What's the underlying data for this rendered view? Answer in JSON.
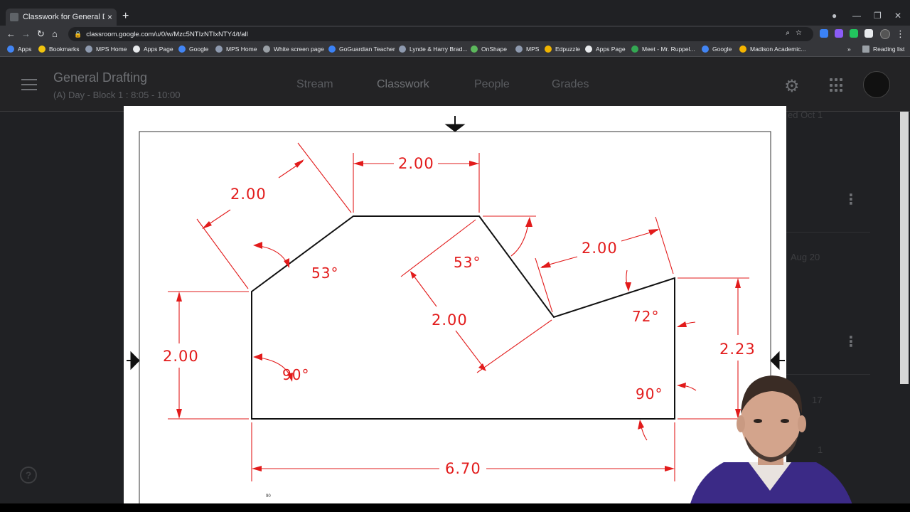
{
  "browser": {
    "tab_title": "Classwork for General Drafting (A",
    "tab_close": "×",
    "new_tab": "+",
    "url": "classroom.google.com/u/0/w/Mzc5NTIzNTIxNTY4/t/all",
    "nav": {
      "back": "←",
      "forward": "→",
      "reload": "↻",
      "home": "⌂"
    },
    "window": {
      "minimize": "—",
      "restore": "❐",
      "close": "✕",
      "record": "●"
    }
  },
  "bookmarks": [
    {
      "label": "Apps",
      "color": "#4285f4"
    },
    {
      "label": "Bookmarks",
      "color": "#f1c40f"
    },
    {
      "label": "MPS Home",
      "color": "#8e9aaf"
    },
    {
      "label": "Apps Page",
      "color": "#e8eaed"
    },
    {
      "label": "Google",
      "color": "#4285f4"
    },
    {
      "label": "MPS Home",
      "color": "#8e9aaf"
    },
    {
      "label": "White screen page",
      "color": "#9aa0a6"
    },
    {
      "label": "GoGuardian Teacher",
      "color": "#3b82f6"
    },
    {
      "label": "Lynde & Harry Brad...",
      "color": "#8e9aaf"
    },
    {
      "label": "OnShape",
      "color": "#5cb85c"
    },
    {
      "label": "MPS",
      "color": "#8e9aaf"
    },
    {
      "label": "Edpuzzle",
      "color": "#f0b400"
    },
    {
      "label": "Apps Page",
      "color": "#e8eaed"
    },
    {
      "label": "Meet - Mr. Ruppel...",
      "color": "#34a853"
    },
    {
      "label": "Google",
      "color": "#4285f4"
    },
    {
      "label": "Madison Academic...",
      "color": "#f4b400"
    }
  ],
  "bookmarks_more": "»",
  "reading_list": "Reading list",
  "classroom": {
    "title": "General Drafting",
    "subtitle": "(A) Day - Block 1 : 8:05 - 10:00",
    "tabs": [
      "Stream",
      "Classwork",
      "People",
      "Grades"
    ],
    "active_tab": "Classwork",
    "bg_dates": [
      "ed Oct 1",
      "Aug 20",
      "17",
      "1"
    ],
    "help": "?"
  },
  "drawing": {
    "dims": {
      "top_width": "2.00",
      "left_chamfer": "2.00",
      "right_chamfer": "2.00",
      "notch_side": "2.00",
      "left_height": "2.00",
      "right_height": "2.23",
      "overall_width": "6.70"
    },
    "angles": {
      "left_chamfer": "53°",
      "right_chamfer": "53°",
      "notch": "72°",
      "bottom_left": "90°",
      "bottom_right": "90°"
    },
    "footer_note": "90",
    "line_color": "#e21b1b",
    "outline_color": "#111111"
  }
}
